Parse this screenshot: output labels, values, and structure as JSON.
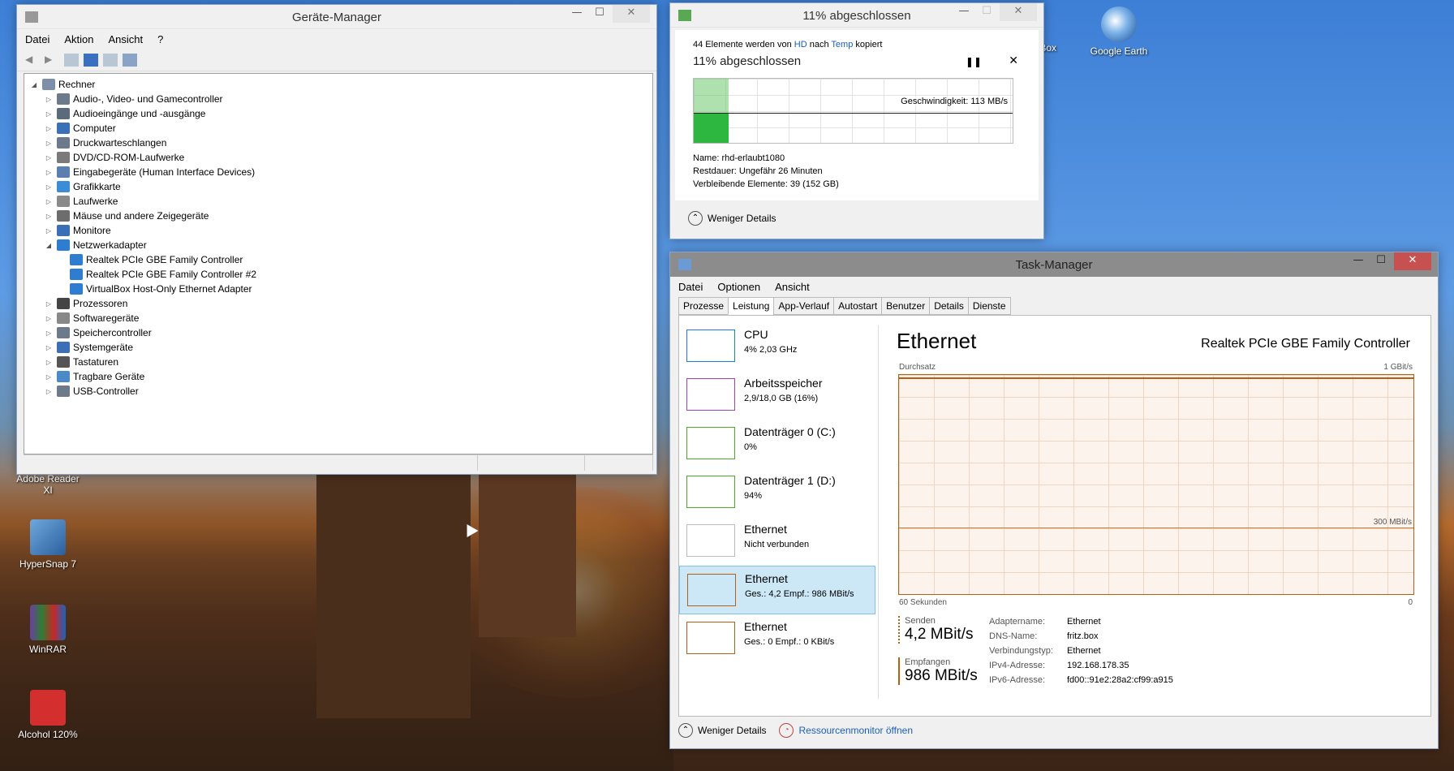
{
  "desktop": {
    "icons": [
      {
        "label": "Google Earth"
      },
      {
        "label": "Adobe Reader XI"
      },
      {
        "label": "HyperSnap 7"
      },
      {
        "label": "WinRAR"
      },
      {
        "label": "Alcohol 120%"
      }
    ],
    "partial_labels": [
      "alBox"
    ]
  },
  "devmgr": {
    "title": "Geräte-Manager",
    "menu": [
      "Datei",
      "Aktion",
      "Ansicht",
      "?"
    ],
    "root": "Rechner",
    "nodes": [
      "Audio-, Video- und Gamecontroller",
      "Audioeingänge und -ausgänge",
      "Computer",
      "Druckwarteschlangen",
      "DVD/CD-ROM-Laufwerke",
      "Eingabegeräte (Human Interface Devices)",
      "Grafikkarte",
      "Laufwerke",
      "Mäuse und andere Zeigegeräte",
      "Monitore",
      "Netzwerkadapter",
      "Prozessoren",
      "Softwaregeräte",
      "Speichercontroller",
      "Systemgeräte",
      "Tastaturen",
      "Tragbare Geräte",
      "USB-Controller"
    ],
    "net_children": [
      "Realtek PCIe GBE Family Controller",
      "Realtek PCIe GBE Family Controller #2",
      "VirtualBox Host-Only Ethernet Adapter"
    ]
  },
  "copy": {
    "title": "11% abgeschlossen",
    "line_prefix": "44 Elemente werden von",
    "from": "HD",
    "mid": "nach",
    "to": "Temp",
    "suffix": "kopiert",
    "progress_label": "11% abgeschlossen",
    "progress": 0.11,
    "speed": "Geschwindigkeit: 113 MB/s",
    "name_label": "Name:",
    "name_value": "rhd-erlaubt1080",
    "rest_label": "Restdauer:",
    "rest_value": "Ungefähr 26 Minuten",
    "remaining_label": "Verbleibende Elemente:",
    "remaining_value": "39 (152 GB)",
    "less_details": "Weniger Details"
  },
  "tm": {
    "title": "Task-Manager",
    "menu": [
      "Datei",
      "Optionen",
      "Ansicht"
    ],
    "tabs": [
      "Prozesse",
      "Leistung",
      "App-Verlauf",
      "Autostart",
      "Benutzer",
      "Details",
      "Dienste"
    ],
    "side": [
      {
        "name": "CPU",
        "sub": "4% 2,03 GHz",
        "color": "#1c7ed6"
      },
      {
        "name": "Arbeitsspeicher",
        "sub": "2,9/18,0 GB (16%)",
        "color": "#a83eb8"
      },
      {
        "name": "Datenträger 0 (C:)",
        "sub": "0%",
        "color": "#4caa2a"
      },
      {
        "name": "Datenträger 1 (D:)",
        "sub": "94%",
        "color": "#4caa2a"
      },
      {
        "name": "Ethernet",
        "sub": "Nicht verbunden",
        "color": "#bbbbbb"
      },
      {
        "name": "Ethernet",
        "sub": "Ges.: 4,2 Empf.: 986 MBit/s",
        "color": "#b75f12"
      },
      {
        "name": "Ethernet",
        "sub": "Ges.: 0 Empf.: 0 KBit/s",
        "color": "#b75f12"
      }
    ],
    "main_title": "Ethernet",
    "adapter": "Realtek PCIe GBE Family Controller",
    "throughput_label": "Durchsatz",
    "max_label": "1 GBit/s",
    "mid_label": "300 MBit/s",
    "time_label": "60 Sekunden",
    "zero_label": "0",
    "send_label": "Senden",
    "send_value": "4,2 MBit/s",
    "recv_label": "Empfangen",
    "recv_value": "986 MBit/s",
    "props": [
      {
        "k": "Adaptername:",
        "v": "Ethernet"
      },
      {
        "k": "DNS-Name:",
        "v": "fritz.box"
      },
      {
        "k": "Verbindungstyp:",
        "v": "Ethernet"
      },
      {
        "k": "IPv4-Adresse:",
        "v": "192.168.178.35"
      },
      {
        "k": "IPv6-Adresse:",
        "v": "fd00::91e2:28a2:cf99:a915"
      }
    ],
    "less_details": "Weniger Details",
    "resmon": "Ressourcenmonitor öffnen"
  }
}
